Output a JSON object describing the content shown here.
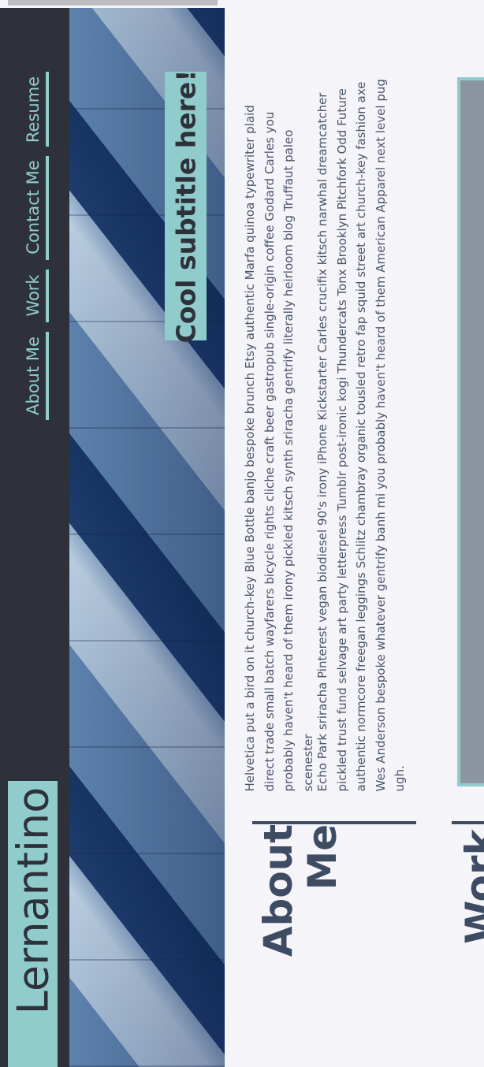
{
  "site": {
    "logo": "Lernantino",
    "subtitle": "Cool subtitle here!"
  },
  "nav": {
    "items": [
      {
        "label": "About Me"
      },
      {
        "label": "Work"
      },
      {
        "label": "Contact Me"
      },
      {
        "label": "Resume"
      }
    ]
  },
  "about": {
    "heading_line1": "About",
    "heading_line2": "Me",
    "paragraphs": [
      "Helvetica put a bird on it church-key Blue Bottle banjo bespoke brunch Etsy authentic Marfa quinoa typewriter plaid direct trade small batch wayfarers bicycle rights cliche craft beer gastropub single-origin coffee Godard Carles you probably haven't heard of them irony pickled kitsch synth sriracha gentrify literally heirloom blog Truffaut paleo scenester",
      "Echo Park sriracha Pinterest vegan biodiesel 90's irony iPhone Kickstarter Carles crucifix kitsch narwhal dreamcatcher pickled trust fund selvage art party letterpress Tumblr post-ironic kogi Thundercats Tonx Brooklyn Pitchfork Odd Future authentic normcore freegan leggings Schlitz chambray organic tousled retro fap squid street art church-key fashion axe Wes Anderson bespoke whatever gentrify banh mi you probably haven't heard of them American Apparel next level pug ugh."
    ]
  },
  "work": {
    "heading": "Work"
  },
  "colors": {
    "accent": "#91cccd",
    "nav_bg": "#2e313a",
    "heading": "#3d4b63",
    "page_bg": "#f5f4f9"
  }
}
